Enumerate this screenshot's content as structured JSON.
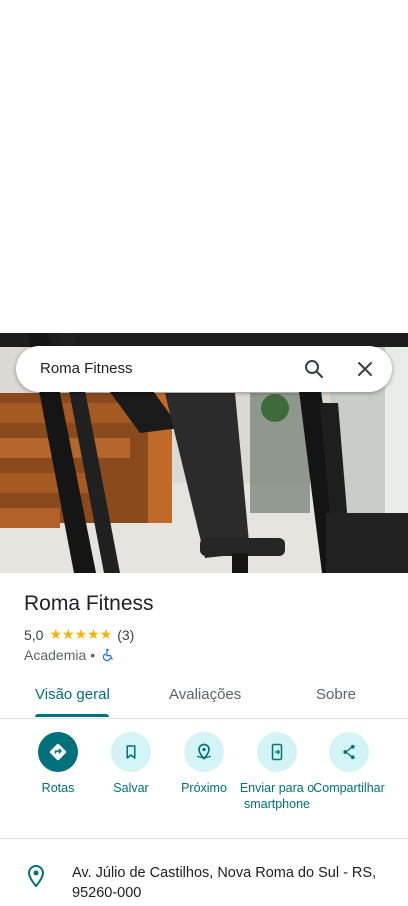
{
  "search": {
    "query": "Roma Fitness"
  },
  "place": {
    "name": "Roma Fitness",
    "rating": "5,0",
    "stars": "★★★★★",
    "review_count": "(3)",
    "category": "Academia",
    "separator": "•",
    "wheelchair_accessible": true
  },
  "tabs": [
    {
      "label": "Visão geral",
      "active": true
    },
    {
      "label": "Avaliações",
      "active": false
    },
    {
      "label": "Sobre",
      "active": false
    }
  ],
  "actions": [
    {
      "label": "Rotas",
      "icon": "directions-icon"
    },
    {
      "label": "Salvar",
      "icon": "bookmark-icon"
    },
    {
      "label": "Próximo",
      "icon": "nearby-icon"
    },
    {
      "label": "Enviar para o smartphone",
      "icon": "send-to-phone-icon"
    },
    {
      "label": "Compartilhar",
      "icon": "share-icon"
    }
  ],
  "address": "Av. Júlio de Castilhos, Nova Roma do Sul - RS, 95260-000",
  "colors": {
    "accent": "#00707a",
    "accent_light": "#d3f3f7",
    "star": "#f5b400"
  }
}
